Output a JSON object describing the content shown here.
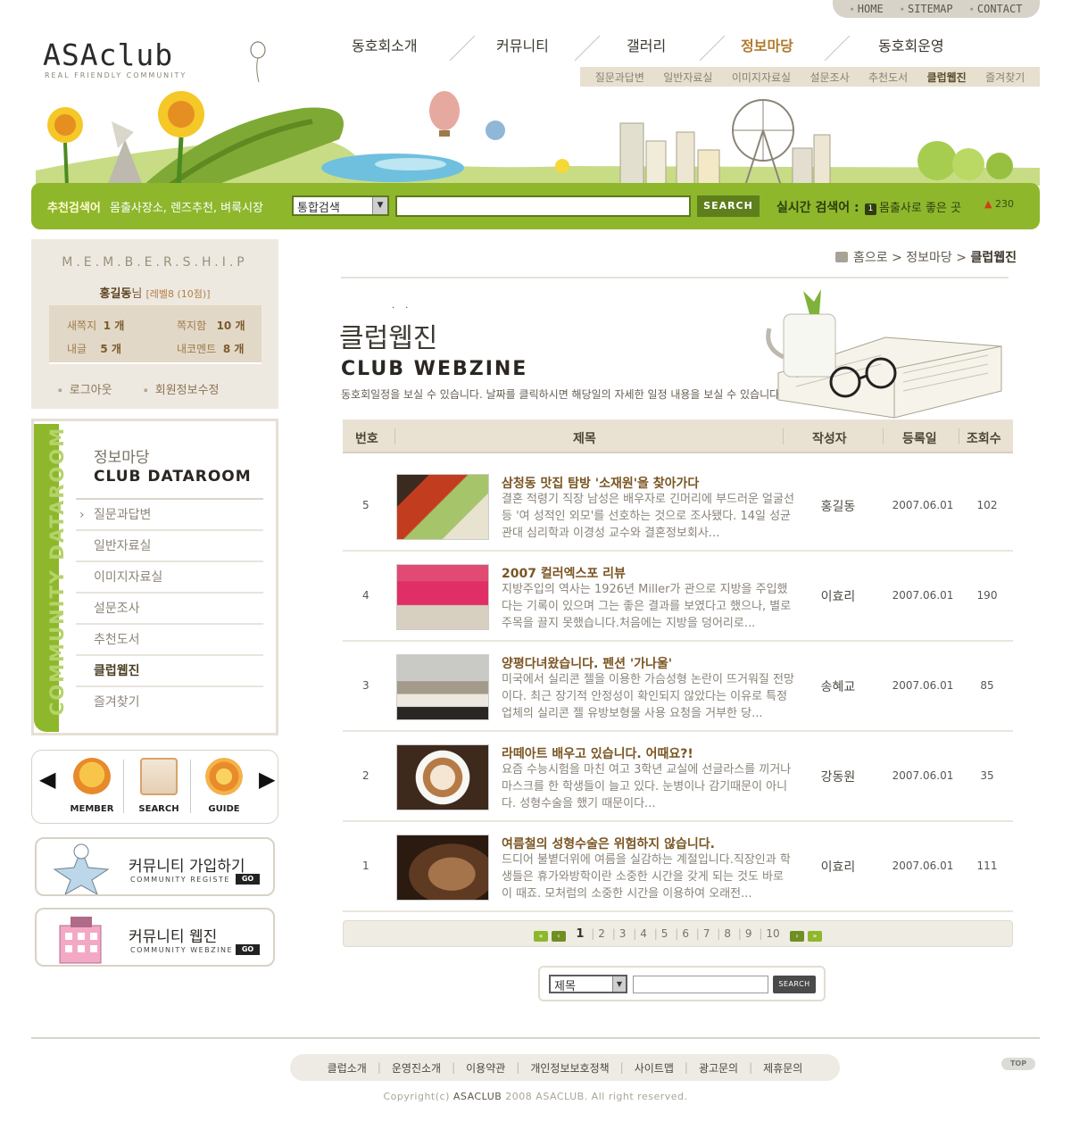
{
  "util": [
    "HOME",
    "SITEMAP",
    "CONTACT"
  ],
  "logo": {
    "name": "ASAclub",
    "tagline": "REAL FRIENDLY COMMUNITY"
  },
  "gnb": [
    "동호회소개",
    "커뮤니티",
    "갤러리",
    "정보마당",
    "동호회운영"
  ],
  "subnav": [
    "질문과답변",
    "일반자료실",
    "이미지자료실",
    "설문조사",
    "추천도서",
    "클럽웹진",
    "즐겨찾기"
  ],
  "search": {
    "recommend_label": "추천검색어",
    "recommend_words": "몸출사장소, 렌즈추천, 벼룩시장",
    "select_value": "통합검색",
    "button": "SEARCH",
    "realtime_label": "실시간 검색어 :",
    "realtime_rank": "1",
    "realtime_word": "몸출사로 좋은 곳",
    "realtime_count": "230"
  },
  "membership": {
    "title": "M.E.M.B.E.R.S.H.I.P",
    "user_name": "홍길동",
    "user_suffix": "님",
    "level": "[레벨8 (10점)]",
    "stats": [
      {
        "label": "새쪽지",
        "value": "1 개"
      },
      {
        "label": "쪽지함",
        "value": "10 개"
      },
      {
        "label": "내글",
        "value": "5 개"
      },
      {
        "label": "내코멘트",
        "value": "8 개"
      }
    ],
    "links": [
      "로그아웃",
      "회원정보수정"
    ]
  },
  "side": {
    "vertical_text": "COMMUNITY DATAROOM",
    "title_ko": "정보마당",
    "title_en": "CLUB DATAROOM",
    "items": [
      "질문과답변",
      "일반자료실",
      "이미지자료실",
      "설문조사",
      "추천도서",
      "클럽웹진",
      "즐겨찾기"
    ]
  },
  "quick": [
    "MEMBER",
    "SEARCH",
    "GUIDE"
  ],
  "banners": [
    {
      "title": "커뮤니티 가입하기",
      "sub": "COMMUNITY REGISTE",
      "go": "GO"
    },
    {
      "title": "커뮤니티 웹진",
      "sub": "COMMUNITY WEBZINE",
      "go": "GO"
    }
  ],
  "breadcrumb": {
    "home": "홈으로",
    "mid": "정보마당",
    "current": "클럽웹진"
  },
  "page_title": {
    "ko": "클럽웹진",
    "en": "CLUB WEBZINE",
    "desc": "동호회일정을 보실 수 있습니다. 날짜를 클릭하시면 해당일의 자세한 일정 내용을 보실 수 있습니다."
  },
  "table": {
    "headers": [
      "번호",
      "제목",
      "작성자",
      "등록일",
      "조회수"
    ],
    "rows": [
      {
        "num": "5",
        "title": "삼청동 맛집 탐방 '소재원'을 찾아가다",
        "summary": "결혼 적령기 직장 남성은 배우자로 긴머리에 부드러운 얼굴선 등 '여 성적인 외모'를 선호하는 것으로 조사됐다. 14일 성균관대 심리학과 이경성 교수와 결혼정보회사...",
        "author": "홍길동",
        "date": "2007.06.01",
        "views": "102"
      },
      {
        "num": "4",
        "title": "2007 컬러엑스포 리뷰",
        "summary": "지방주입의 역사는 1926년 Miller가 관으로 지방을 주입했다는 기록이 있으며 그는 좋은 결과를 보였다고 했으나, 별로 주목을 끌지 못했습니다.처음에는 지방을 덩어리로...",
        "author": "이효리",
        "date": "2007.06.01",
        "views": "190"
      },
      {
        "num": "3",
        "title": "양평다녀왔습니다. 펜션 '가나울'",
        "summary": "미국에서 실리콘 젤을 이용한 가슴성형 논란이 뜨거워질 전망이다. 최근 장기적 안정성이 확인되지 않았다는 이유로 특정업체의 실리콘 젤 유방보형물 사용 요청을 거부한 당...",
        "author": "송혜교",
        "date": "2007.06.01",
        "views": "85"
      },
      {
        "num": "2",
        "title": "라떼아트 배우고 있습니다. 어때요?!",
        "summary": "요즘 수능시험을 마친 여고 3학년 교실에 선글라스를 끼거나 마스크를 한 학생들이 늘고 있다. 눈병이나 감기때문이 아니다. 성형수술을 했기 때문이다...",
        "author": "강동원",
        "date": "2007.06.01",
        "views": "35"
      },
      {
        "num": "1",
        "title": "여름철의 성형수술은 위험하지 않습니다.",
        "summary": "드디어 불볕더위에 여름을 실감하는 계절입니다.직장인과 학생들은 휴가와방학이란 소중한 시간을 갖게 되는 것도 바로 이 때죠. 모처럼의 소중한 시간을 이용하여 오래전...",
        "author": "이효리",
        "date": "2007.06.01",
        "views": "111"
      }
    ]
  },
  "paging": {
    "current": "1",
    "pages": [
      "2",
      "3",
      "4",
      "5",
      "6",
      "7",
      "8",
      "9",
      "10"
    ]
  },
  "bottom_search": {
    "select_value": "제목",
    "button": "SEARCH"
  },
  "footer": {
    "links": [
      "클럽소개",
      "운영진소개",
      "이용약관",
      "개인정보보호정책",
      "사이트맵",
      "광고문의",
      "제휴문의"
    ],
    "top": "TOP",
    "copyright_pre": "Copyright(c)",
    "copyright_brand": "ASACLUB",
    "copyright_post": "2008 ASACLUB. All right reserved."
  },
  "colors": {
    "accent_green": "#8eb72c",
    "active_orange": "#b17a2d",
    "beige": "#eee9e0"
  }
}
